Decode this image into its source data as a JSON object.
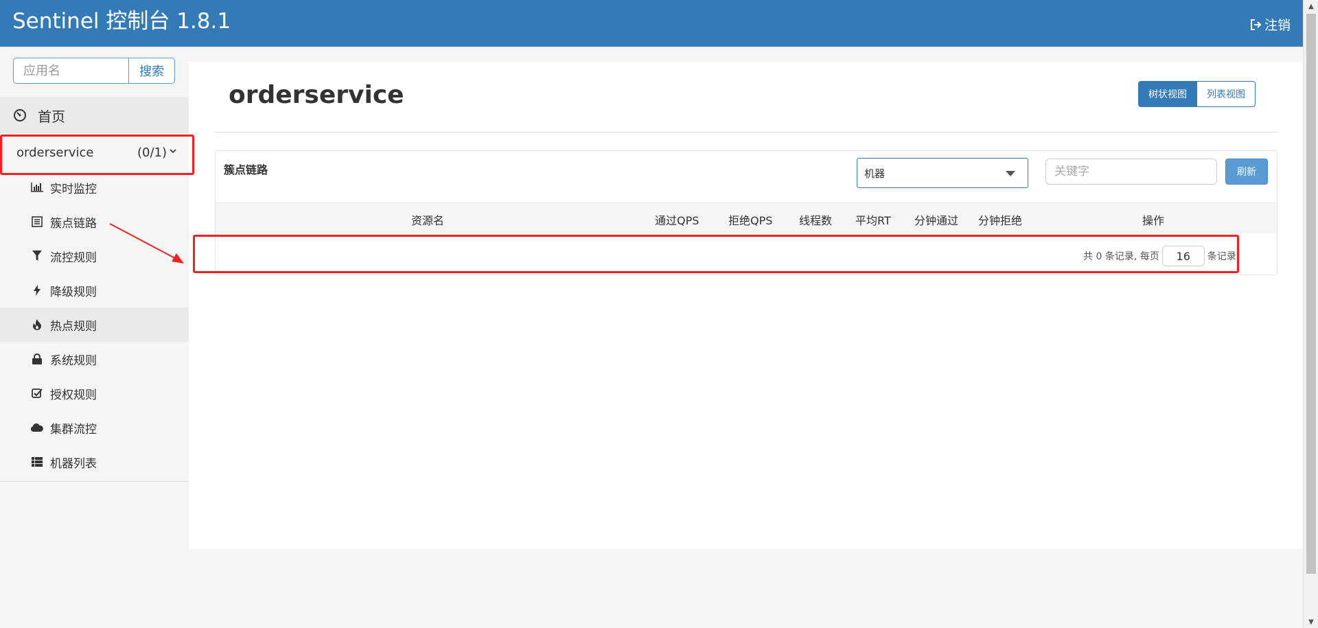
{
  "header": {
    "title": "Sentinel 控制台 1.8.1",
    "logout_label": "注销"
  },
  "sidebar": {
    "search_placeholder": "应用名",
    "search_button": "搜索",
    "home_label": "首页",
    "app": {
      "name": "orderservice",
      "count": "(0/1)"
    },
    "items": [
      {
        "label": "实时监控",
        "icon": "bar-chart-icon"
      },
      {
        "label": "簇点链路",
        "icon": "list-icon"
      },
      {
        "label": "流控规则",
        "icon": "filter-icon"
      },
      {
        "label": "降级规则",
        "icon": "flash-icon"
      },
      {
        "label": "热点规则",
        "icon": "fire-icon"
      },
      {
        "label": "系统规则",
        "icon": "lock-icon"
      },
      {
        "label": "授权规则",
        "icon": "check-icon"
      },
      {
        "label": "集群流控",
        "icon": "cloud-icon"
      },
      {
        "label": "机器列表",
        "icon": "th-list-icon"
      }
    ]
  },
  "main": {
    "title": "orderservice",
    "view_tree": "树状视图",
    "view_list": "列表视图",
    "panel_title": "簇点链路",
    "machine_select": "机器",
    "keyword_placeholder": "关键字",
    "refresh_button": "刷新",
    "columns": [
      "资源名",
      "通过QPS",
      "拒绝QPS",
      "线程数",
      "平均RT",
      "分钟通过",
      "分钟拒绝",
      "操作"
    ],
    "pager": {
      "summary": "共 0 条记录, 每页",
      "page_size": "16",
      "suffix": "条记录"
    }
  },
  "colors": {
    "header": "#337ab7",
    "annotation": "#ee2222"
  }
}
